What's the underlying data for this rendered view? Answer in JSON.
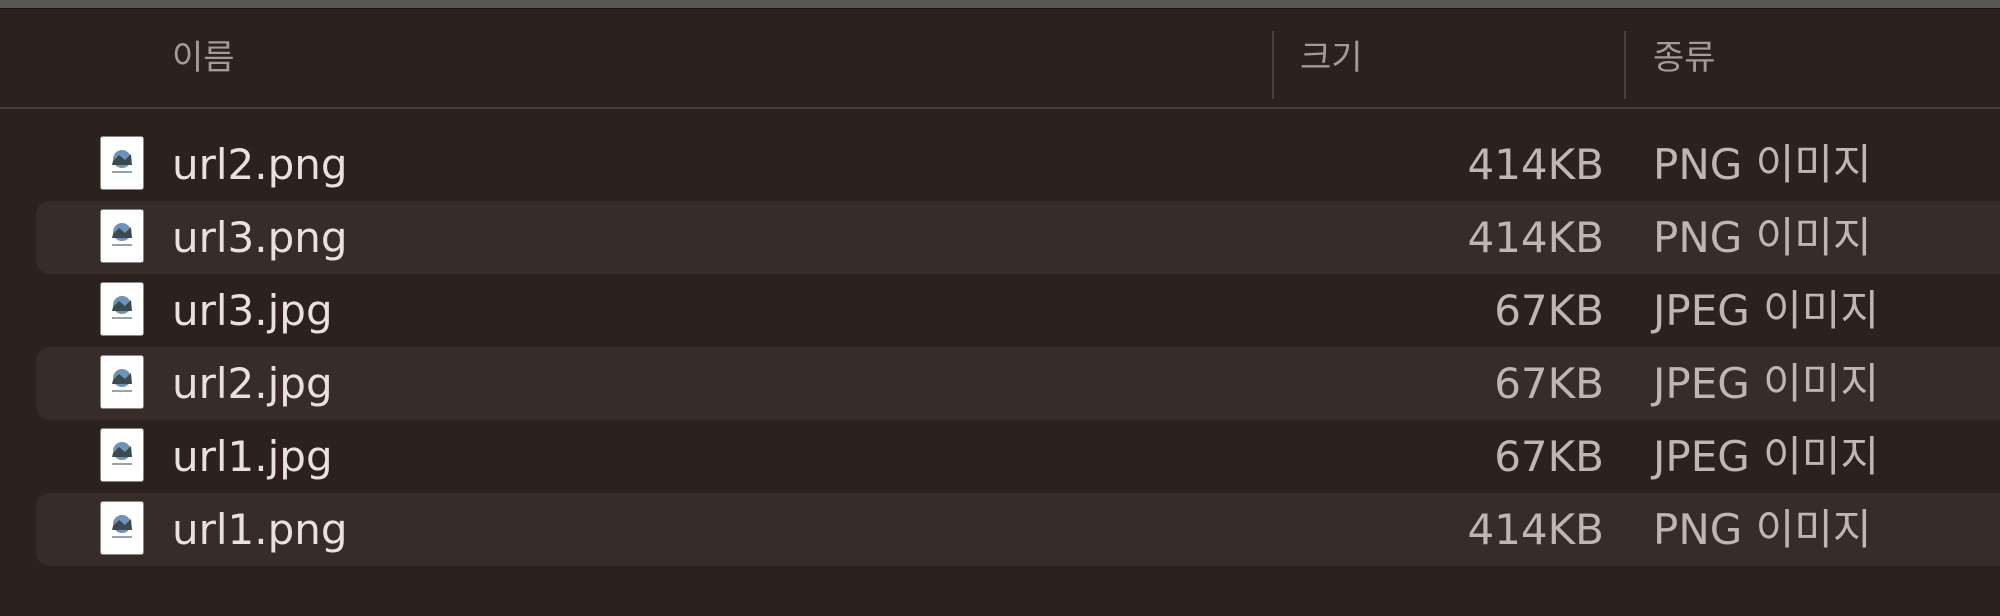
{
  "header": {
    "name": "이름",
    "size": "크기",
    "kind": "종류"
  },
  "files": [
    {
      "name": "url2.png",
      "size": "414KB",
      "kind": "PNG 이미지",
      "icon": "image-file-icon"
    },
    {
      "name": "url3.png",
      "size": "414KB",
      "kind": "PNG 이미지",
      "icon": "image-file-icon"
    },
    {
      "name": "url3.jpg",
      "size": "67KB",
      "kind": "JPEG 이미지",
      "icon": "image-file-icon"
    },
    {
      "name": "url2.jpg",
      "size": "67KB",
      "kind": "JPEG 이미지",
      "icon": "image-file-icon"
    },
    {
      "name": "url1.jpg",
      "size": "67KB",
      "kind": "JPEG 이미지",
      "icon": "image-file-icon"
    },
    {
      "name": "url1.png",
      "size": "414KB",
      "kind": "PNG 이미지",
      "icon": "image-file-icon"
    }
  ]
}
